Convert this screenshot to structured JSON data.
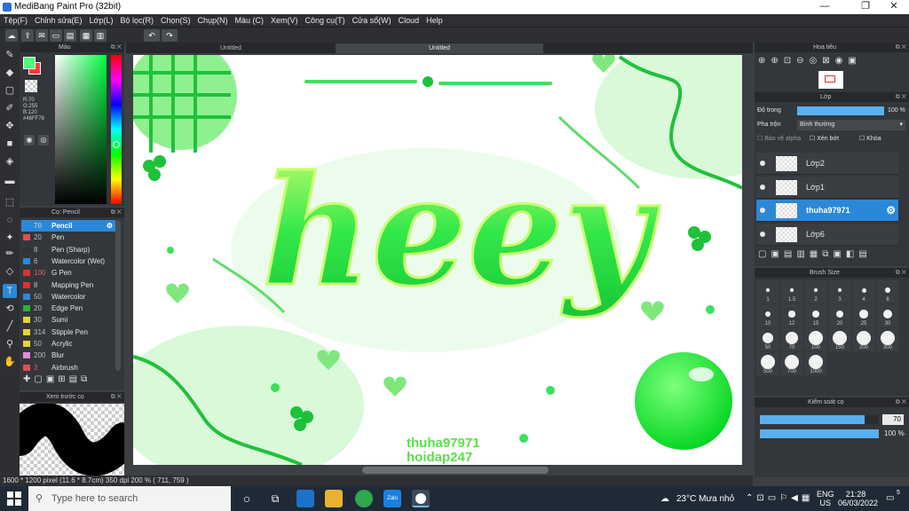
{
  "window": {
    "title": "MediBang Paint Pro (32bit)",
    "min": "—",
    "max": "❐",
    "close": "✕"
  },
  "menu": [
    "Tệp(F)",
    "Chỉnh sửa(E)",
    "Lớp(L)",
    "Bộ lọc(R)",
    "Chọn(S)",
    "Chụp(N)",
    "Màu (C)",
    "Xem(V)",
    "Công cụ(T)",
    "Cửa sổ(W)",
    "Cloud",
    "Help"
  ],
  "tabs": [
    "Untitled",
    "Untitled"
  ],
  "color_panel": {
    "title": "Màu",
    "rgb": "R:70\nG:255\nB:120",
    "hex": "#46FF78",
    "fg": "#46ff78",
    "bg": "#ff3a3a"
  },
  "brush_panel": {
    "title": "Cọ: Pencil",
    "items": [
      {
        "size": "70",
        "name": "Pencil",
        "chip": "#2b88d8",
        "selected": true
      },
      {
        "size": "20",
        "name": "Pen",
        "chip": "#e05050"
      },
      {
        "size": "8",
        "name": "Pen (Sharp)",
        "chip": "#333333"
      },
      {
        "size": "6",
        "name": "Watercolor (Wet)",
        "chip": "#2b88d8"
      },
      {
        "size": "100",
        "name": "G Pen",
        "chip": "#e03030",
        "red": true
      },
      {
        "size": "8",
        "name": "Mapping Pen",
        "chip": "#e03030"
      },
      {
        "size": "50",
        "name": "Watercolor",
        "chip": "#2b88d8"
      },
      {
        "size": "20",
        "name": "Edge Pen",
        "chip": "#2fb13a"
      },
      {
        "size": "30",
        "name": "Sumi",
        "chip": "#e8d13a"
      },
      {
        "size": "314",
        "name": "Stipple Pen",
        "chip": "#e8d13a"
      },
      {
        "size": "50",
        "name": "Acrylic",
        "chip": "#e8d13a"
      },
      {
        "size": "200",
        "name": "Blur",
        "chip": "#e48bd8"
      },
      {
        "size": "3",
        "name": "Airbrush",
        "chip": "#e05050",
        "red": true
      }
    ]
  },
  "preview_panel": {
    "title": "Xem trước cọ"
  },
  "navigator": {
    "title": "Hoa tiêu"
  },
  "layer_panel": {
    "title": "Lớp",
    "opacity_label": "Độ trong",
    "opacity_value": "100 %",
    "blend_label": "Pha trộn",
    "blend_value": "Bình thường",
    "protect_alpha": "Bảo vệ alpha",
    "clipping": "Xén bớt",
    "lock": "Khóa",
    "layers": [
      {
        "name": "Lớp2"
      },
      {
        "name": "Lớp1"
      },
      {
        "name": "thuha97971",
        "selected": true
      },
      {
        "name": "Lớp6"
      }
    ]
  },
  "brush_size_panel": {
    "title": "Brush Size",
    "sizes": [
      "1",
      "1.5",
      "2",
      "3",
      "4",
      "6",
      "10",
      "12",
      "15",
      "20",
      "25",
      "30",
      "50",
      "70",
      "100",
      "150",
      "200",
      "300",
      "500",
      "700",
      "1000"
    ]
  },
  "control_panel": {
    "title": "Kiểm soát cọ",
    "size_value": "70",
    "size_fraction": 0.88,
    "opacity_value": "100 %",
    "opacity_fraction": 1.0
  },
  "status": "1600 * 1200 pixel   (11.6 * 8.7cm)   350 dpi   200 %   ( 711, 759 )",
  "artwork": {
    "word": "heey",
    "credit1": "thuha97971",
    "credit2": "hoidap247"
  },
  "taskbar": {
    "search_placeholder": "Type here to search",
    "weather": "23°C  Mưa nhỏ",
    "lang1": "ENG",
    "lang2": "US",
    "time": "21:28",
    "date": "06/03/2022",
    "notif": "5"
  }
}
